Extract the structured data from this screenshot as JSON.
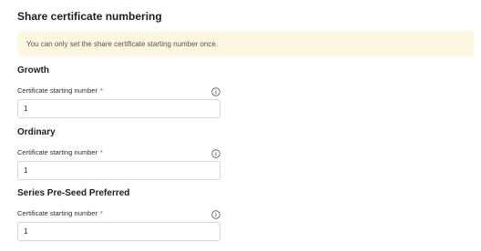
{
  "page": {
    "title": "Share certificate numbering",
    "notice": "You can only set the share certificate starting number once."
  },
  "sections": [
    {
      "title": "Growth",
      "field_label": "Certificate starting number",
      "required_mark": "*",
      "value": "1"
    },
    {
      "title": "Ordinary",
      "field_label": "Certificate starting number",
      "required_mark": "*",
      "value": "1"
    },
    {
      "title": "Series Pre-Seed Preferred",
      "field_label": "Certificate starting number",
      "required_mark": "*",
      "value": "1"
    }
  ],
  "icons": {
    "info": "info-circle-icon"
  }
}
